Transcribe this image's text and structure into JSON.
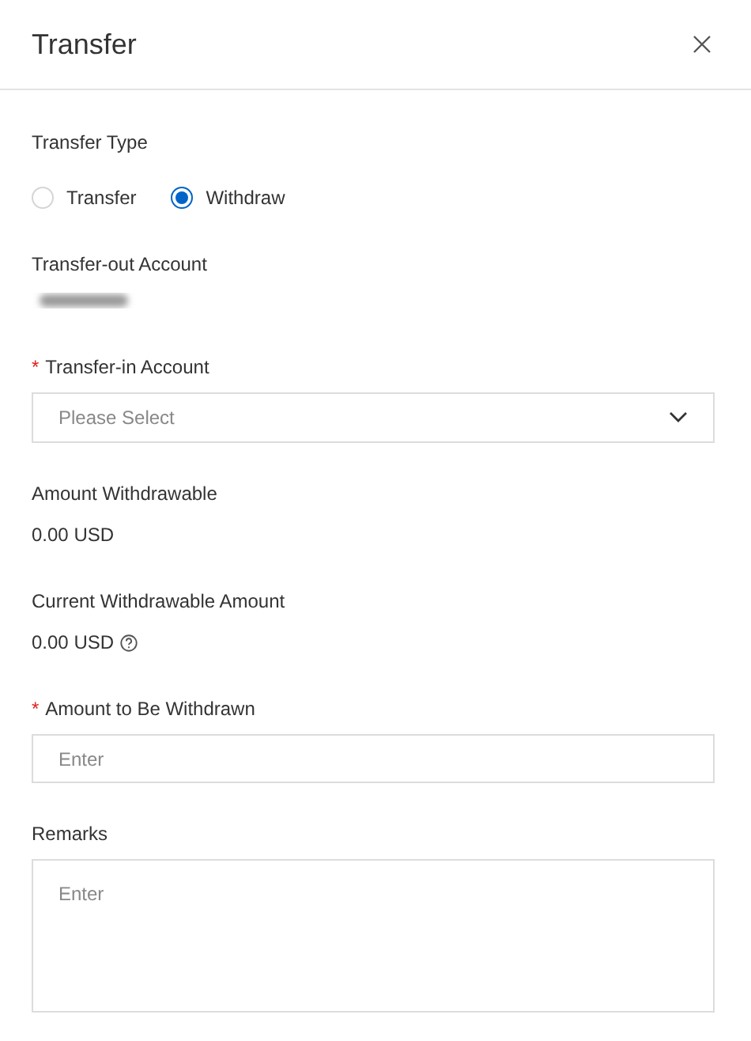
{
  "dialog": {
    "title": "Transfer"
  },
  "fields": [
    {
      "kind": "radio",
      "label": "Transfer Type",
      "options": [
        {
          "label": "Transfer",
          "selected": false
        },
        {
          "label": "Withdraw",
          "selected": true
        }
      ]
    },
    {
      "kind": "redacted",
      "label": "Transfer-out Account"
    },
    {
      "kind": "select",
      "label": "Transfer-in Account",
      "required_mark": "*",
      "placeholder": "Please Select"
    },
    {
      "kind": "value",
      "label": "Amount Withdrawable",
      "value": "0.00 USD",
      "help": false
    },
    {
      "kind": "value",
      "label": "Current Withdrawable Amount",
      "value": "0.00 USD",
      "help": true
    },
    {
      "kind": "input",
      "label": "Amount to Be Withdrawn",
      "required_mark": "*",
      "placeholder": "Enter"
    },
    {
      "kind": "textarea",
      "label": "Remarks",
      "placeholder": "Enter"
    }
  ]
}
